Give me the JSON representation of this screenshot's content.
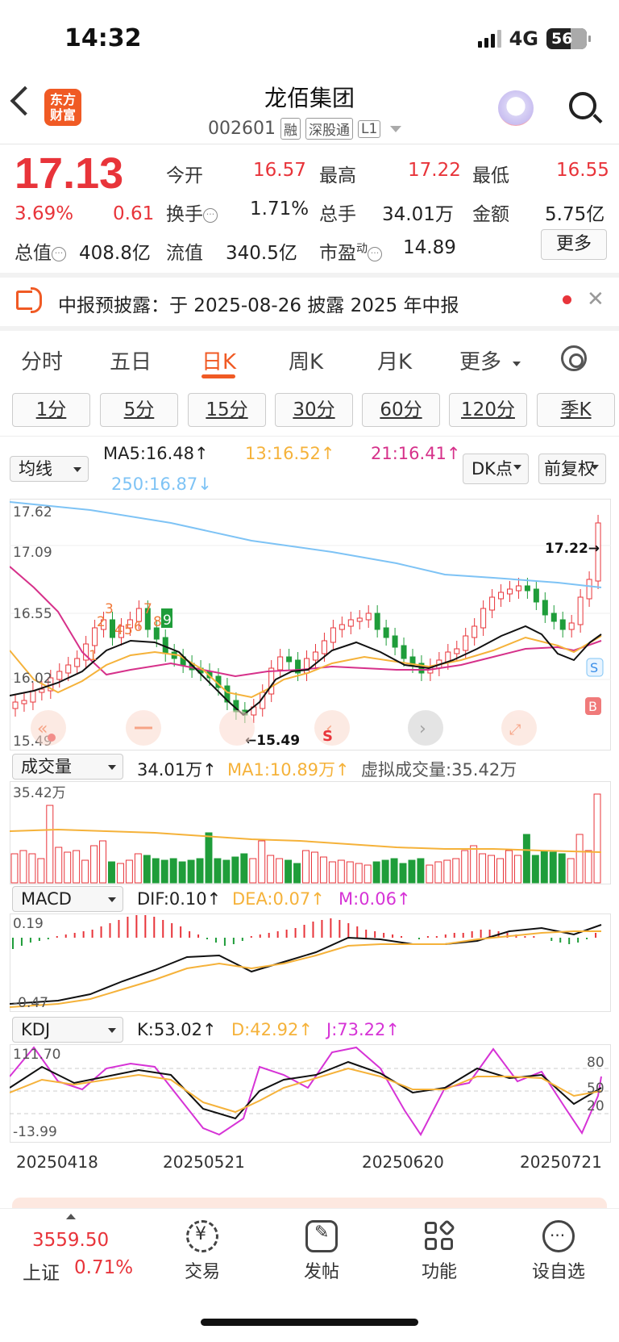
{
  "status": {
    "time": "14:32",
    "network": "4G",
    "battery": "56"
  },
  "header": {
    "title": "龙佰集团",
    "code": "002601",
    "tags": [
      "融",
      "深股通",
      "L1"
    ],
    "logo_text": "东方财富"
  },
  "quote": {
    "price": "17.13",
    "change_pct": "3.69%",
    "change": "0.61",
    "open_label": "今开",
    "open": "16.57",
    "high_label": "最高",
    "high": "17.22",
    "low_label": "最低",
    "low": "16.55",
    "turnover_label": "换手",
    "turnover": "1.71%",
    "volume_label": "总手",
    "volume": "34.01万",
    "amount_label": "金额",
    "amount": "5.75亿",
    "mktcap_label": "总值",
    "mktcap": "408.8亿",
    "float_label": "流值",
    "float": "340.5亿",
    "pe_label": "市盈",
    "pe_sup": "动",
    "pe": "14.89",
    "more": "更多"
  },
  "notice": {
    "text": "中报预披露：于 2025-08-26 披露 2025 年中报"
  },
  "period_tabs": [
    "分时",
    "五日",
    "日K",
    "周K",
    "月K",
    "更多"
  ],
  "active_tab": "日K",
  "minute_buttons": [
    "1分",
    "5分",
    "15分",
    "30分",
    "60分",
    "120分",
    "季K"
  ],
  "ma_legend": {
    "selector": "均线",
    "ma5": "MA5:16.48↑",
    "ma13": "13:16.52↑",
    "ma21": "21:16.41↑",
    "ma250": "250:16.87↓",
    "dk": "DK点",
    "adjust": "前复权"
  },
  "kline_axis": {
    "top": "17.62",
    "mid1": "17.09",
    "mid2": "16.55",
    "mid3": "16.02",
    "bottom": "15.49",
    "high_mark": "17.22→",
    "low_mark": "←15.49"
  },
  "nine_turn": [
    "1",
    "2",
    "3",
    "4",
    "5",
    "6",
    "7",
    "8",
    "9"
  ],
  "volume_legend": {
    "selector": "成交量",
    "vol": "34.01万↑",
    "ma1": "MA1:10.89万↑",
    "virtual": "虚拟成交量:35.42万",
    "axis_top": "35.42万"
  },
  "macd_legend": {
    "selector": "MACD",
    "dif": "DIF:0.10↑",
    "dea": "DEA:0.07↑",
    "m": "M:0.06↑",
    "axis_top": "0.19",
    "axis_bottom": "-0.47"
  },
  "kdj_legend": {
    "selector": "KDJ",
    "k": "K:53.02↑",
    "d": "D:42.92↑",
    "j": "J:73.22↑",
    "axis_top": "111.70",
    "axis_bottom": "-13.99",
    "r80": "80",
    "r50": "50",
    "r20": "20"
  },
  "dates": [
    "20250418",
    "20250521",
    "20250620",
    "20250721"
  ],
  "bottom_nav": {
    "index_value": "3559.50",
    "index_name": "上证",
    "index_change": "0.71%",
    "items": [
      "交易",
      "发帖",
      "功能",
      "设自选"
    ]
  },
  "colors": {
    "up": "#e8343a",
    "down": "#1f9d3a",
    "accent": "#f05a24",
    "ma250": "#7ec3f5",
    "ma13": "#f5b23a",
    "ma21": "#d6318a"
  },
  "chart_data": {
    "type": "candlestick",
    "ylim": [
      15.49,
      17.62
    ],
    "x": [
      "20250418",
      "20250521",
      "20250620",
      "20250721"
    ],
    "last_close": 17.13,
    "high": 17.22,
    "low": 15.49
  }
}
